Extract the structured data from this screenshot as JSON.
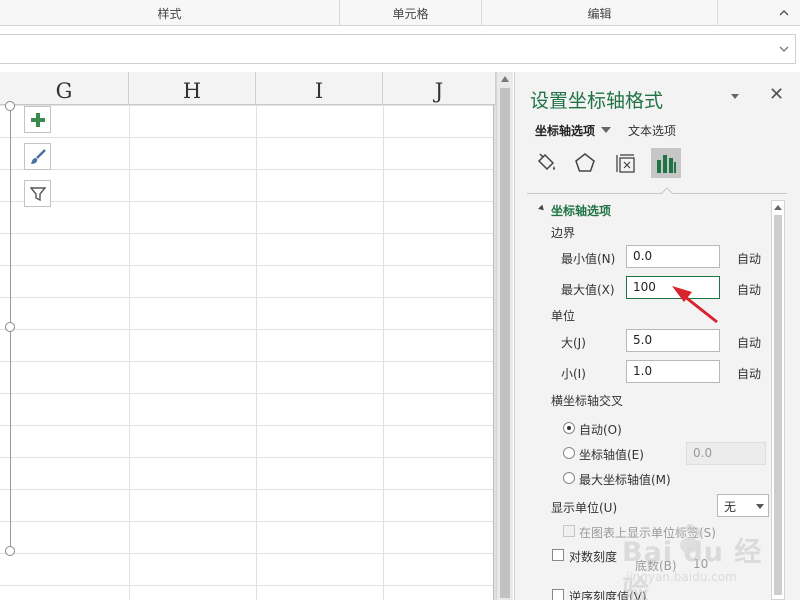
{
  "ribbon": {
    "groups": [
      "样式",
      "单元格",
      "编辑"
    ]
  },
  "sheet": {
    "columns": [
      "G",
      "H",
      "I",
      "J"
    ]
  },
  "chart_tools": [
    "plus-icon",
    "brush-icon",
    "filter-icon"
  ],
  "pane": {
    "title": "设置坐标轴格式",
    "tab_axis_options": "坐标轴选项",
    "tab_text_options": "文本选项",
    "icons": [
      "fill-bucket-icon",
      "pentagon-icon",
      "size-properties-icon",
      "bar-chart-icon"
    ],
    "section_axis_options": "坐标轴选项",
    "bounds": {
      "label": "边界",
      "min_label": "最小值(N)",
      "min_value": "0.0",
      "max_label": "最大值(X)",
      "max_value": "100",
      "auto": "自动"
    },
    "units": {
      "label": "单位",
      "major_label": "大(J)",
      "major_value": "5.0",
      "minor_label": "小(I)",
      "minor_value": "1.0"
    },
    "crosses": {
      "label": "横坐标轴交叉",
      "auto": "自动(O)",
      "axis_value": "坐标轴值(E)",
      "axis_value_field": "0.0",
      "max_axis_value": "最大坐标轴值(M)"
    },
    "display_units": {
      "label": "显示单位(U)",
      "value": "无",
      "show_label": "在图表上显示单位标签(S)"
    },
    "log_scale": {
      "label": "对数刻度",
      "base_label": "底数(B)",
      "base_value": "10"
    },
    "reverse": {
      "label": "逆序刻度值(V)"
    }
  },
  "colors": {
    "accent": "#217346",
    "arrow": "#d9232d"
  },
  "watermark": {
    "text": "Bai du 经验",
    "url": "jingyan.baidu.com"
  }
}
